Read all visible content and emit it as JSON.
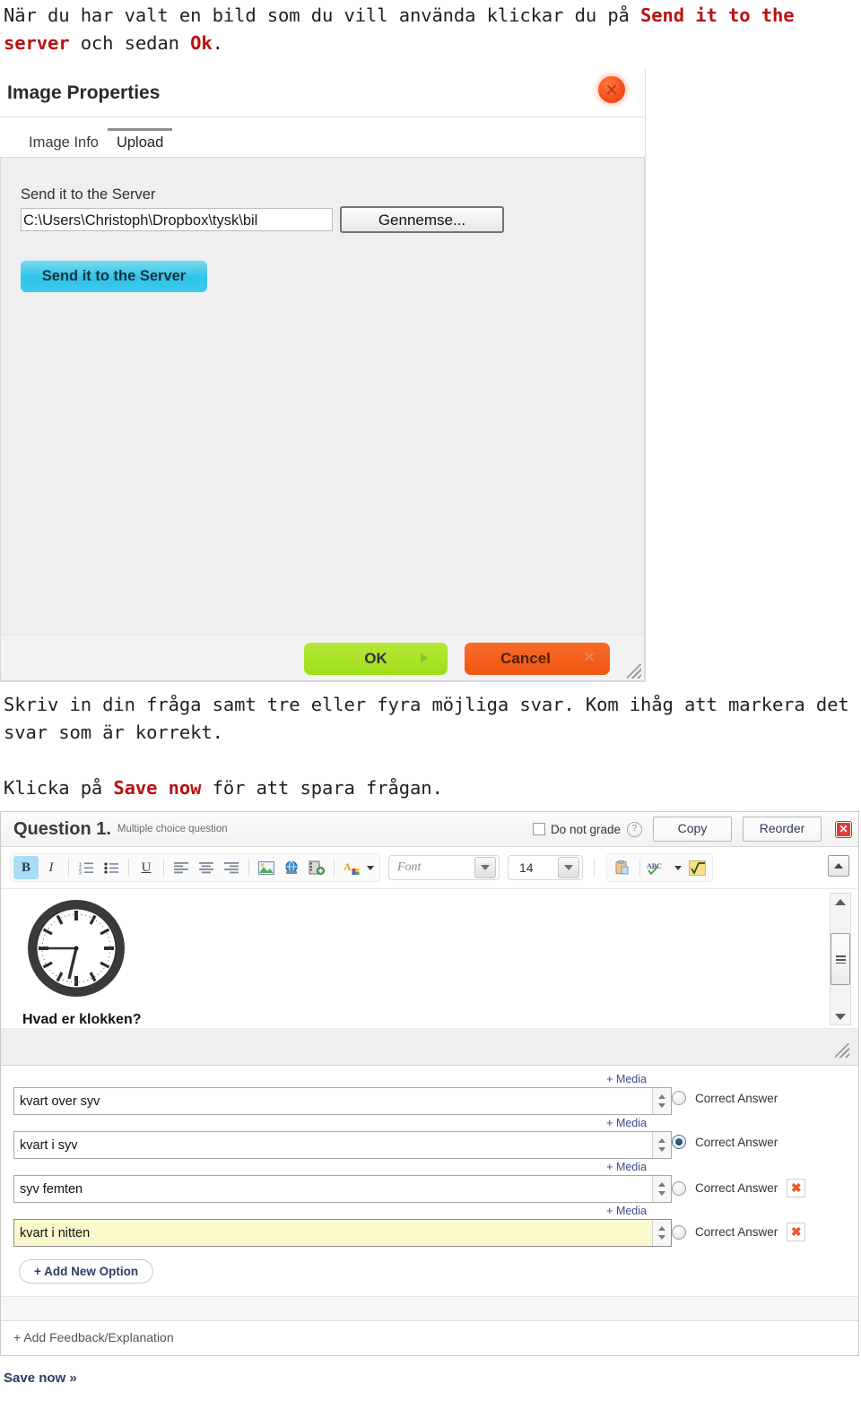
{
  "intro": {
    "line1_a": "När du har valt en bild som du vill använda klickar du på ",
    "line1_hi": "Send it to the server",
    "line1_b": " och sedan ",
    "line1_hi2": "Ok",
    "line1_c": "."
  },
  "image_dialog": {
    "title": "Image Properties",
    "close_icon": "close-circle-icon",
    "tabs": [
      {
        "label": "Image Info",
        "active": false
      },
      {
        "label": "Upload",
        "active": true
      }
    ],
    "upload": {
      "field_label": "Send it to the Server",
      "path_value": "C:\\Users\\Christoph\\Dropbox\\tysk\\bil",
      "browse_label": "Gennemse...",
      "send_label": "Send it to the Server"
    },
    "footer": {
      "ok_label": "OK",
      "cancel_label": "Cancel",
      "ok_icon": "play-arrow-icon",
      "cancel_icon": "x-icon",
      "resize_icon": "resize-grip-icon"
    }
  },
  "middle": {
    "p1": "Skriv in din fråga samt tre eller fyra möjliga svar. Kom ihåg att markera det svar som är korrekt.",
    "p2_a": "Klicka på ",
    "p2_hi": "Save now",
    "p2_b": " för att spara frågan."
  },
  "question_editor": {
    "header": {
      "title": "Question 1.",
      "subtitle": "Multiple choice question",
      "do_not_grade_label": "Do not grade",
      "do_not_grade_checked": false,
      "help_icon": "question-mark-icon",
      "copy_label": "Copy",
      "reorder_label": "Reorder",
      "close_icon": "red-close-icon"
    },
    "toolbar": {
      "buttons": [
        {
          "name": "bold",
          "glyph": "B",
          "active": true
        },
        {
          "name": "italic",
          "glyph": "I",
          "active": false
        },
        {
          "name": "ordered-list",
          "glyph": "list-ordered",
          "active": false
        },
        {
          "name": "unordered-list",
          "glyph": "list-bullet",
          "active": false
        },
        {
          "name": "underline",
          "glyph": "U",
          "active": false
        },
        {
          "name": "align-left",
          "glyph": "align-left",
          "active": false
        },
        {
          "name": "align-center",
          "glyph": "align-center",
          "active": false
        },
        {
          "name": "align-right",
          "glyph": "align-right",
          "active": false
        },
        {
          "name": "insert-image",
          "glyph": "image",
          "active": false
        },
        {
          "name": "insert-link",
          "glyph": "globe-link",
          "active": false
        },
        {
          "name": "insert-video",
          "glyph": "film-add",
          "active": false
        },
        {
          "name": "text-color",
          "glyph": "A-color",
          "active": false
        },
        {
          "name": "paste",
          "glyph": "clipboard",
          "active": false
        },
        {
          "name": "spellcheck",
          "glyph": "ABC",
          "active": false
        },
        {
          "name": "math",
          "glyph": "sqrt",
          "active": false
        }
      ],
      "font_placeholder": "Font",
      "font_size_value": "14",
      "collapse_icon": "caret-up-icon"
    },
    "canvas": {
      "image_alt": "analog-clock-image",
      "question_text": "Hvad er klokken?",
      "scrollbar_icon": "vertical-scrollbar",
      "resize_icon": "resize-grip-icon"
    },
    "media_label": "+ Media",
    "correct_answer_label": "Correct Answer",
    "options": [
      {
        "text": "kvart over syv",
        "correct": false,
        "deletable": false,
        "focused": false
      },
      {
        "text": "kvart i syv",
        "correct": true,
        "deletable": false,
        "focused": false
      },
      {
        "text": "syv femten",
        "correct": false,
        "deletable": true,
        "focused": false
      },
      {
        "text": "kvart i nitten",
        "correct": false,
        "deletable": true,
        "focused": true
      }
    ],
    "delete_icon": "orange-x-icon",
    "add_option_label": "+ Add New Option",
    "add_feedback_label": "+ Add Feedback/Explanation",
    "save_now_label": "Save now »"
  },
  "colors": {
    "accent_red": "#bb1111",
    "send_button": "#2fc3e8",
    "ok_button": "#9ede1a",
    "cancel_button": "#ef5412",
    "delete_orange": "#ef5a22",
    "close_red": "#e23b33",
    "link_blue": "#3c4b8a"
  }
}
